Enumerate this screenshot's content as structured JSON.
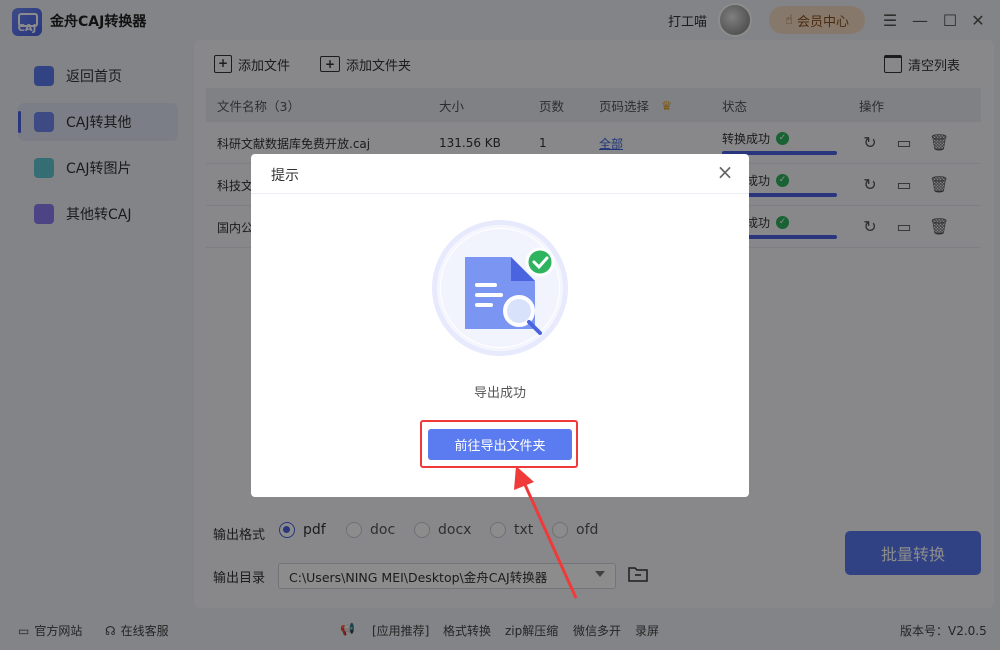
{
  "app": {
    "title": "金舟CAJ转换器",
    "logo_text": "CAJ",
    "username": "打工喵",
    "vip_label": "会员中心"
  },
  "sidebar": {
    "items": [
      {
        "label": "返回首页",
        "icon": "home-icon"
      },
      {
        "label": "CAJ转其他",
        "icon": "caj-to-other-icon"
      },
      {
        "label": "CAJ转图片",
        "icon": "caj-to-image-icon"
      },
      {
        "label": "其他转CAJ",
        "icon": "other-to-caj-icon"
      }
    ]
  },
  "toolbar": {
    "add_file": "添加文件",
    "add_folder": "添加文件夹",
    "clear_list": "清空列表"
  },
  "table": {
    "headers": {
      "name": "文件名称（3）",
      "size": "大小",
      "pages": "页数",
      "range": "页码选择",
      "status": "状态",
      "ops": "操作"
    },
    "rows": [
      {
        "name": "科研文献数据库免费开放.caj",
        "size": "131.56 KB",
        "pages": "1",
        "range": "全部",
        "status": "转换成功",
        "progress": 1.0
      },
      {
        "name": "科技文",
        "size": "",
        "pages": "",
        "range": "",
        "status": "转换成功",
        "progress": 1.0
      },
      {
        "name": "国内公",
        "size": "",
        "pages": "",
        "range": "",
        "status": "转换成功",
        "progress": 1.0
      }
    ]
  },
  "output": {
    "format_label": "输出格式",
    "formats": [
      "pdf",
      "doc",
      "docx",
      "txt",
      "ofd"
    ],
    "selected_format": "pdf",
    "dir_label": "输出目录",
    "dir_value": "C:\\Users\\NING MEI\\Desktop\\金舟CAJ转换器",
    "batch_label": "批量转换"
  },
  "footer": {
    "website": "官方网站",
    "service": "在线客服",
    "recommend": "[应用推荐]",
    "links": [
      "格式转换",
      "zip解压缩",
      "微信多开",
      "录屏"
    ],
    "version": "版本号：V2.0.5"
  },
  "dialog": {
    "title": "提示",
    "message": "导出成功",
    "button": "前往导出文件夹"
  },
  "colors": {
    "accent": "#4b63e6",
    "success": "#2eb35f",
    "highlight": "#f03a3a"
  }
}
